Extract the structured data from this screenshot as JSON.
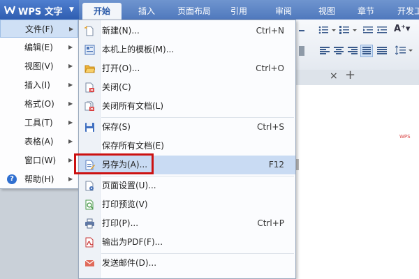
{
  "app": {
    "title": "WPS 文字"
  },
  "ribbon_tabs": [
    "开始",
    "插入",
    "页面布局",
    "引用",
    "审阅",
    "视图",
    "章节",
    "开发工"
  ],
  "document_tabs": {
    "add_label": "+",
    "close_label": "×"
  },
  "main_menu": [
    {
      "label": "文件(F)",
      "icon": null
    },
    {
      "label": "编辑(E)",
      "icon": null
    },
    {
      "label": "视图(V)",
      "icon": null
    },
    {
      "label": "插入(I)",
      "icon": null
    },
    {
      "label": "格式(O)",
      "icon": null
    },
    {
      "label": "工具(T)",
      "icon": null
    },
    {
      "label": "表格(A)",
      "icon": null
    },
    {
      "label": "窗口(W)",
      "icon": null
    },
    {
      "label": "帮助(H)",
      "icon": "help-icon"
    }
  ],
  "file_menu": [
    {
      "label": "新建(N)...",
      "shortcut": "Ctrl+N",
      "icon": "new-document-icon"
    },
    {
      "label": "本机上的模板(M)...",
      "shortcut": "",
      "icon": "template-icon"
    },
    {
      "label": "打开(O)...",
      "shortcut": "Ctrl+O",
      "icon": "open-folder-icon"
    },
    {
      "label": "关闭(C)",
      "shortcut": "",
      "icon": "close-document-icon"
    },
    {
      "label": "关闭所有文档(L)",
      "shortcut": "",
      "icon": "close-all-documents-icon"
    },
    {
      "label": "保存(S)",
      "shortcut": "Ctrl+S",
      "icon": "save-icon"
    },
    {
      "label": "保存所有文档(E)",
      "shortcut": "",
      "icon": null
    },
    {
      "label": "另存为(A)...",
      "shortcut": "F12",
      "icon": "save-as-icon"
    },
    {
      "label": "页面设置(U)...",
      "shortcut": "",
      "icon": "page-setup-icon"
    },
    {
      "label": "打印预览(V)",
      "shortcut": "",
      "icon": "print-preview-icon"
    },
    {
      "label": "打印(P)...",
      "shortcut": "Ctrl+P",
      "icon": "print-icon"
    },
    {
      "label": "输出为PDF(F)...",
      "shortcut": "",
      "icon": "pdf-export-icon"
    },
    {
      "label": "发送邮件(D)...",
      "shortcut": "",
      "icon": "mail-icon"
    }
  ],
  "colors": {
    "highlight": "#cc1111",
    "selected_item": "#c9dbf3",
    "title_bar": "#4f78bd"
  }
}
